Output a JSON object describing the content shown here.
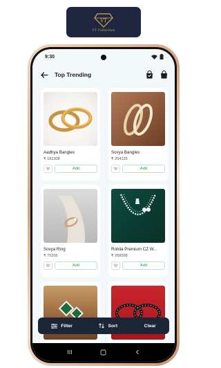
{
  "brand": {
    "logo_text": "VT Collection",
    "logo_mark": "VT"
  },
  "status": {
    "time": "9:30"
  },
  "appbar": {
    "title": "Top Trending"
  },
  "products": [
    {
      "name": "Aadhya Bangles",
      "price": "₹ 181308",
      "add_label": "Add"
    },
    {
      "name": "Sovya Bangles",
      "price": "₹ 204135",
      "add_label": "Add"
    },
    {
      "name": "Sovya Ring",
      "price": "₹ 75205",
      "add_label": "Add"
    },
    {
      "name": "Rohila Premium CZ W...",
      "price": "₹ 268598",
      "add_label": "Add"
    },
    {
      "name": "",
      "price": "",
      "add_label": ""
    },
    {
      "name": "",
      "price": "",
      "add_label": ""
    }
  ],
  "bottom_bar": {
    "filter_label": "Filter",
    "sort_label": "Sort",
    "clear_label": "Clear"
  },
  "colors": {
    "accent_green": "#2e9a4b",
    "bar_dark": "#1b2637",
    "brand_navy": "#1f2740",
    "gold": "#d3a84f"
  },
  "icons": [
    "back-arrow-icon",
    "cart-icon",
    "bag-icon",
    "heart-icon",
    "filter-icon",
    "sort-icon",
    "wifi-icon",
    "battery-icon"
  ]
}
